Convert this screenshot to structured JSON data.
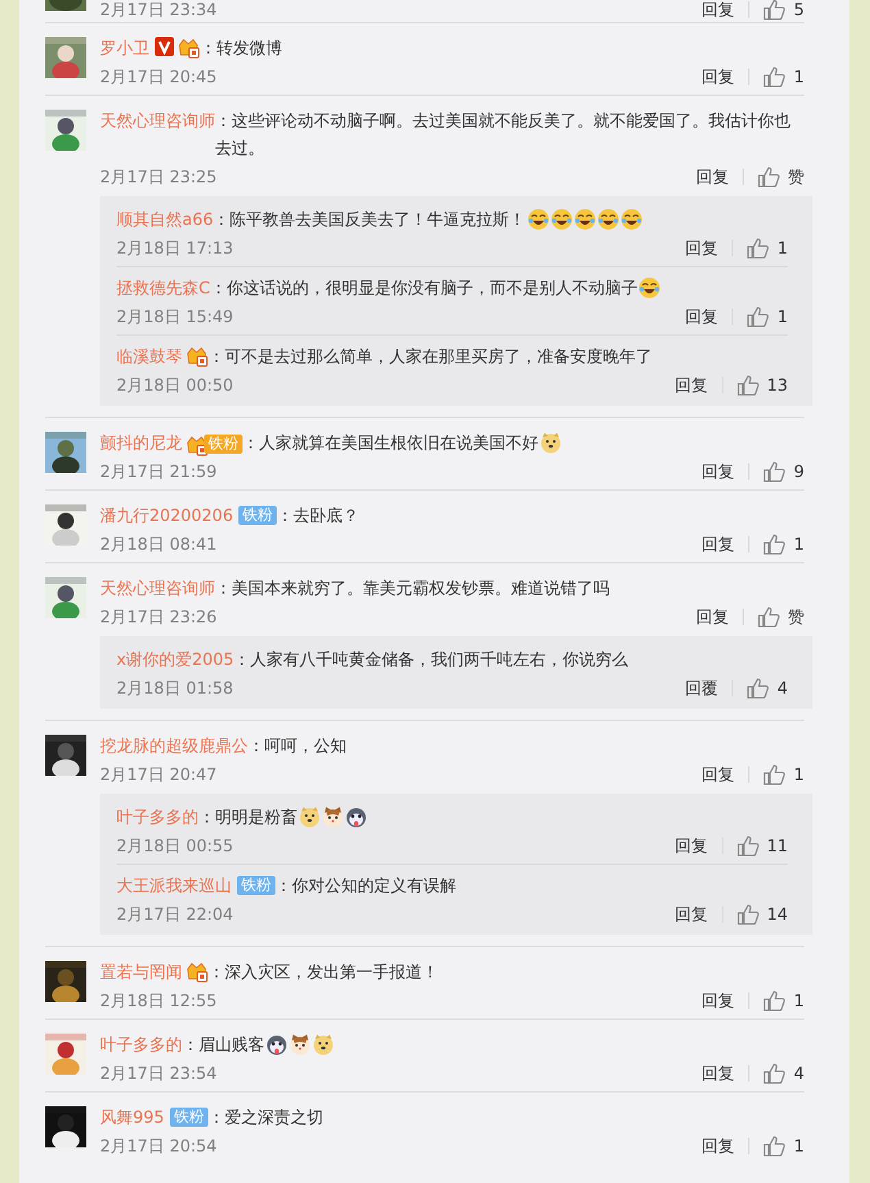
{
  "top_cut": {
    "time": "2月17日 23:34",
    "reply_label": "回复",
    "likes": "5"
  },
  "comments": [
    {
      "name": "罗小卫",
      "badges": [
        {
          "kind": "verified"
        },
        {
          "kind": "crown"
        }
      ],
      "text": "：转发微博",
      "time": "2月17日 20:45",
      "reply_label": "回复",
      "likes": "1"
    },
    {
      "name": "天然心理咨询师",
      "text": "：这些评论动不动脑子啊。去过美国就不能反美了。就不能爱国了。我估计你也去过。",
      "time": "2月17日 23:25",
      "reply_label": "回复",
      "likes": "赞",
      "replies": [
        {
          "name": "顺其自然a66",
          "text": "：陈平教兽去美国反美去了！牛逼克拉斯！",
          "emoji": [
            {
              "kind": "laugh"
            },
            {
              "kind": "laugh"
            },
            {
              "kind": "laugh"
            },
            {
              "kind": "laugh"
            },
            {
              "kind": "laugh"
            }
          ],
          "time": "2月18日 17:13",
          "reply_label": "回复",
          "likes": "1"
        },
        {
          "name": "拯救德先森C",
          "text": "：你这话说的，很明显是你没有脑子，而不是别人不动脑子",
          "emoji": [
            {
              "kind": "laugh"
            }
          ],
          "time": "2月18日 15:49",
          "reply_label": "回复",
          "likes": "1"
        },
        {
          "name": "临溪鼓琴",
          "badges": [
            {
              "kind": "crown"
            }
          ],
          "text": "：可不是去过那么简单，人家在那里买房了，准备安度晚年了",
          "time": "2月18日 00:50",
          "reply_label": "回复",
          "likes": "13"
        }
      ]
    },
    {
      "name": "颤抖的尼龙",
      "badges": [
        {
          "kind": "crown_fan",
          "label": "铁粉"
        }
      ],
      "text": "：人家就算在美国生根依旧在说美国不好",
      "emoji": [
        {
          "kind": "doge"
        }
      ],
      "time": "2月17日 21:59",
      "reply_label": "回复",
      "likes": "9"
    },
    {
      "name": "潘九行20200206",
      "badges": [
        {
          "kind": "fan",
          "label": "铁粉"
        }
      ],
      "text": "：去卧底？",
      "time": "2月18日 08:41",
      "reply_label": "回复",
      "likes": "1"
    },
    {
      "name": "天然心理咨询师",
      "text": "：美国本来就穷了。靠美元霸权发钞票。难道说错了吗",
      "time": "2月17日 23:26",
      "reply_label": "回复",
      "likes": "赞",
      "replies": [
        {
          "name": "x谢你的爱2005",
          "text": "：人家有八千吨黄金储备，我们两千吨左右，你说穷么",
          "time": "2月18日 01:58",
          "reply_label": "回覆",
          "likes": "4"
        }
      ]
    },
    {
      "name": "挖龙脉的超级鹿鼎公",
      "text": "：呵呵，公知",
      "time": "2月17日 20:47",
      "reply_label": "回复",
      "likes": "1",
      "replies": [
        {
          "name": "叶子多多的",
          "text": "：明明是粉畜",
          "emoji": [
            {
              "kind": "doge"
            },
            {
              "kind": "cat"
            },
            {
              "kind": "husky"
            }
          ],
          "time": "2月18日 00:55",
          "reply_label": "回复",
          "likes": "11"
        },
        {
          "name": "大王派我来巡山",
          "badges": [
            {
              "kind": "fan",
              "label": "铁粉"
            }
          ],
          "text": "：你对公知的定义有误解",
          "time": "2月17日 22:04",
          "reply_label": "回复",
          "likes": "14"
        }
      ]
    },
    {
      "name": "置若与罔闻",
      "badges": [
        {
          "kind": "crown"
        }
      ],
      "text": "：深入灾区，发出第一手报道！",
      "time": "2月18日 12:55",
      "reply_label": "回复",
      "likes": "1"
    },
    {
      "name": "叶子多多的",
      "text": "：眉山贱客",
      "emoji": [
        {
          "kind": "husky"
        },
        {
          "kind": "cat"
        },
        {
          "kind": "doge"
        }
      ],
      "time": "2月17日 23:54",
      "reply_label": "回复",
      "likes": "4"
    },
    {
      "name": "风舞995",
      "badges": [
        {
          "kind": "fan",
          "label": "铁粉"
        }
      ],
      "text": "：爱之深责之切",
      "time": "2月17日 20:54",
      "reply_label": "回复",
      "likes": "1"
    }
  ]
}
